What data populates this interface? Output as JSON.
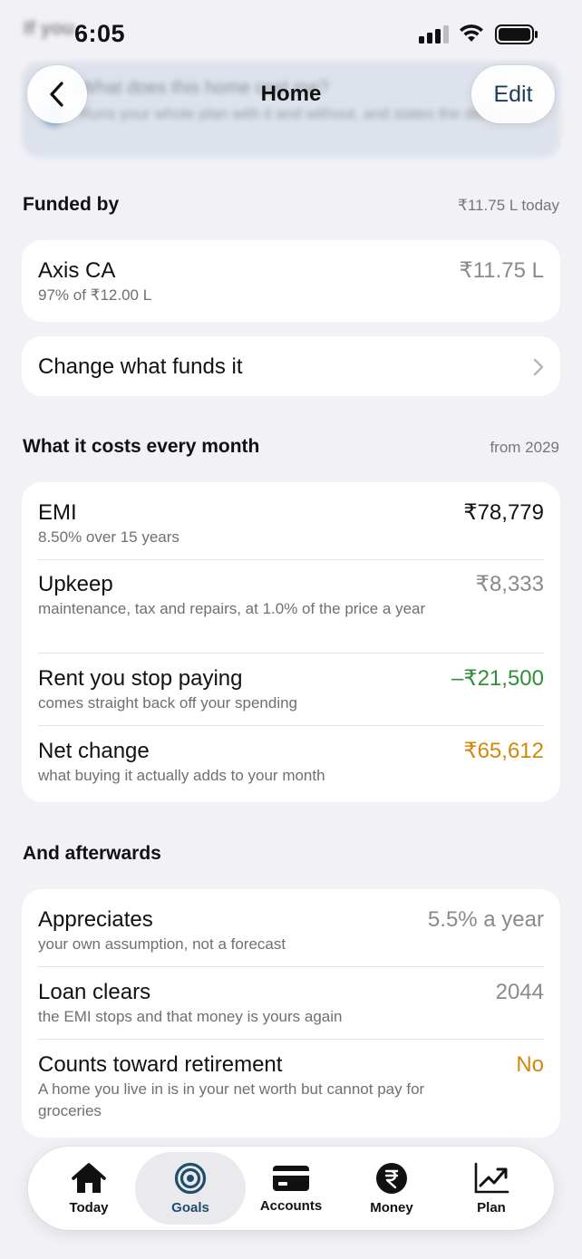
{
  "status": {
    "time": "6:05"
  },
  "ghost": {
    "heading": "If you",
    "question": "What does this home cost me?",
    "answer": "Runs your whole plan with it and without, and states the difference"
  },
  "nav": {
    "title": "Home",
    "edit_label": "Edit"
  },
  "funded_by": {
    "title": "Funded by",
    "right": "₹11.75 L today",
    "account": {
      "name": "Axis CA",
      "detail": "97% of ₹12.00 L",
      "amount": "₹11.75 L"
    },
    "change_label": "Change what funds it"
  },
  "monthly": {
    "title": "What it costs every month",
    "right": "from 2029",
    "rows": [
      {
        "label": "EMI",
        "sub": "8.50% over 15 years",
        "value": "₹78,779"
      },
      {
        "label": "Upkeep",
        "sub": "maintenance, tax and repairs, at 1.0% of the price a year",
        "value": "₹8,333"
      },
      {
        "label": "Rent you stop paying",
        "sub": "comes straight back off your spending",
        "value": "–₹21,500"
      },
      {
        "label": "Net change",
        "sub": "what buying it actually adds to your month",
        "value": "₹65,612"
      }
    ]
  },
  "afterwards": {
    "title": "And afterwards",
    "rows": [
      {
        "label": "Appreciates",
        "sub": "your own assumption, not a forecast",
        "value": "5.5% a year"
      },
      {
        "label": "Loan clears",
        "sub": "the EMI stops and that money is yours again",
        "value": "2044"
      },
      {
        "label": "Counts toward retirement",
        "sub": "A home you live in is in your net worth but cannot pay for groceries",
        "value": "No"
      }
    ]
  },
  "tabs": [
    {
      "label": "Today",
      "icon": "house-icon"
    },
    {
      "label": "Goals",
      "icon": "target-icon",
      "active": true
    },
    {
      "label": "Accounts",
      "icon": "card-icon"
    },
    {
      "label": "Money",
      "icon": "rupee-icon"
    },
    {
      "label": "Plan",
      "icon": "chart-up-icon"
    }
  ],
  "colors": {
    "green": "#2f8f3a",
    "orange": "#d4870a",
    "accent": "#1f4e6b"
  }
}
